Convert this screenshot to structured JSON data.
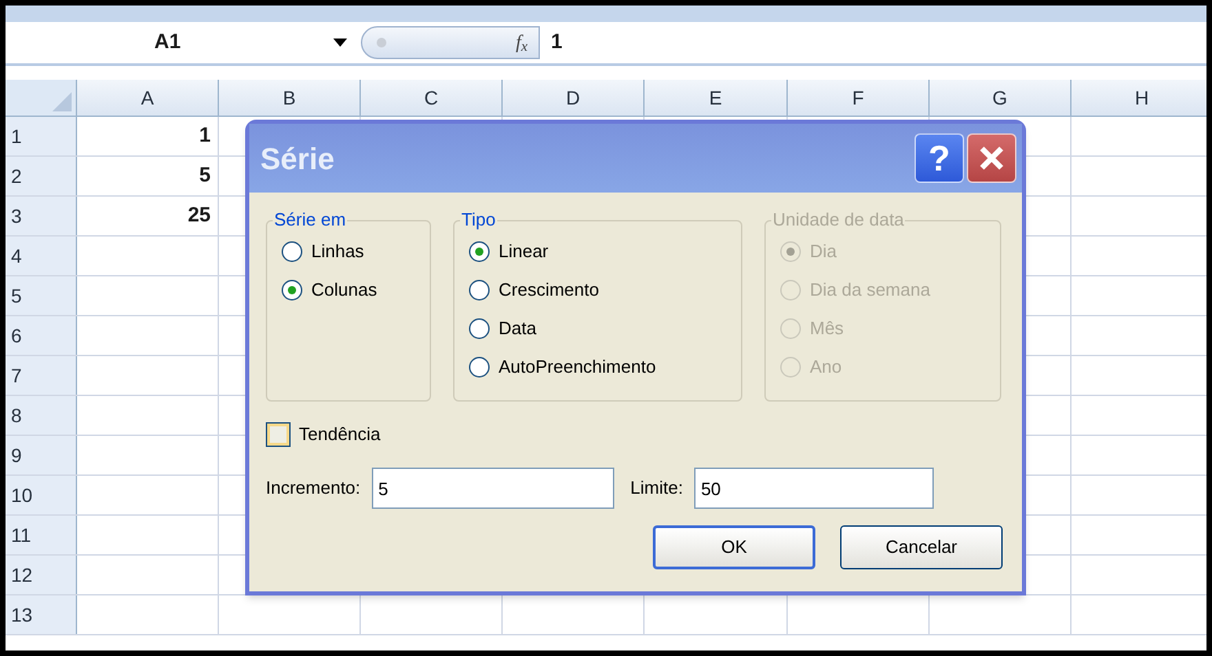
{
  "formula_bar": {
    "name_box": "A1",
    "function_label": "f$_{x}$",
    "value": "1"
  },
  "columns": [
    "A",
    "B",
    "C",
    "D",
    "E",
    "F",
    "G",
    "H"
  ],
  "rows": [
    {
      "header": "1",
      "cells": [
        "1"
      ]
    },
    {
      "header": "2",
      "cells": [
        "5"
      ]
    },
    {
      "header": "3",
      "cells": [
        "25"
      ]
    },
    {
      "header": "4"
    },
    {
      "header": "5"
    },
    {
      "header": "6"
    },
    {
      "header": "7"
    },
    {
      "header": "8"
    },
    {
      "header": "9"
    },
    {
      "header": "10"
    },
    {
      "header": "11"
    },
    {
      "header": "12"
    },
    {
      "header": "13"
    }
  ],
  "dialog": {
    "title": "Série",
    "help_button": "?",
    "groups": [
      {
        "label": "Série em",
        "disabled": false,
        "options": [
          {
            "label": "Linhas",
            "selected": false
          },
          {
            "label": "Colunas",
            "selected": true
          }
        ]
      },
      {
        "label": "Tipo",
        "disabled": false,
        "options": [
          {
            "label": "Linear",
            "selected": true
          },
          {
            "label": "Crescimento",
            "selected": false
          },
          {
            "label": "Data",
            "selected": false
          },
          {
            "label": "AutoPreenchimento",
            "selected": false
          }
        ]
      },
      {
        "label": "Unidade de data",
        "disabled": true,
        "options": [
          {
            "label": "Dia",
            "selected": true
          },
          {
            "label": "Dia da semana",
            "selected": false
          },
          {
            "label": "Mês",
            "selected": false
          },
          {
            "label": "Ano",
            "selected": false
          }
        ]
      }
    ],
    "checkbox": {
      "label": "Tendência",
      "checked": false
    },
    "fields": [
      {
        "label": "Incremento:",
        "value": "5"
      },
      {
        "label": "Limite:",
        "value": "50"
      }
    ],
    "buttons": [
      {
        "label": "OK",
        "default": true
      },
      {
        "label": "Cancelar",
        "default": false
      }
    ]
  }
}
